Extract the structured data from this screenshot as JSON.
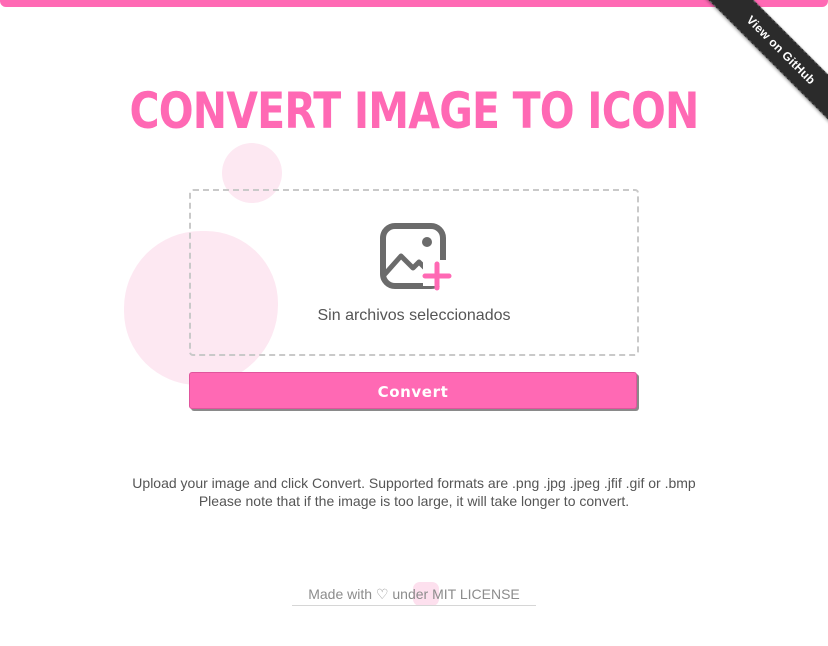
{
  "header": {
    "title": "CONVERT IMAGE TO ICON"
  },
  "ribbon": {
    "label": "View on GitHub"
  },
  "uploader": {
    "icon": "image-add-icon",
    "status": "Sin archivos seleccionados"
  },
  "actions": {
    "convert_label": "Convert"
  },
  "info": {
    "line1": "Upload your image and click Convert. Supported formats are .png .jpg .jpeg .jfif .gif or .bmp",
    "line2": "Please note that if the image is too large, it will take longer to convert."
  },
  "footer": {
    "made_with": "Made with",
    "heart": "♡",
    "under": "under",
    "license_link": "MIT LICENSE"
  },
  "colors": {
    "accent": "#ff69b4",
    "blob": "#fde8f2",
    "text": "#555555",
    "ribbon": "#2b2b2b"
  }
}
